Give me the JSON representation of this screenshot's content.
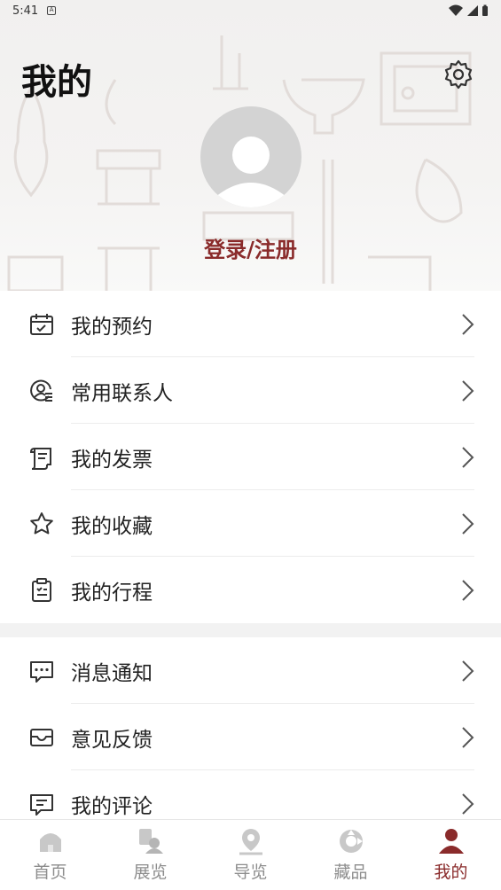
{
  "status_bar": {
    "time": "5:41"
  },
  "header": {
    "title": "我的",
    "login_label": "登录/注册"
  },
  "menu_group_1": [
    {
      "label": "我的预约",
      "icon": "calendar-check-icon"
    },
    {
      "label": "常用联系人",
      "icon": "contact-icon"
    },
    {
      "label": "我的发票",
      "icon": "invoice-icon"
    },
    {
      "label": "我的收藏",
      "icon": "star-icon"
    },
    {
      "label": "我的行程",
      "icon": "clipboard-icon"
    }
  ],
  "menu_group_2": [
    {
      "label": "消息通知",
      "icon": "message-icon"
    },
    {
      "label": "意见反馈",
      "icon": "feedback-icon"
    },
    {
      "label": "我的评论",
      "icon": "comment-icon"
    }
  ],
  "tab_bar": [
    {
      "label": "首页",
      "icon": "home-icon"
    },
    {
      "label": "展览",
      "icon": "exhibition-icon"
    },
    {
      "label": "导览",
      "icon": "location-icon"
    },
    {
      "label": "藏品",
      "icon": "collection-icon"
    },
    {
      "label": "我的",
      "icon": "profile-icon",
      "active": true
    }
  ],
  "colors": {
    "accent": "#8a2b2b",
    "inactive": "#8d8d8d"
  }
}
